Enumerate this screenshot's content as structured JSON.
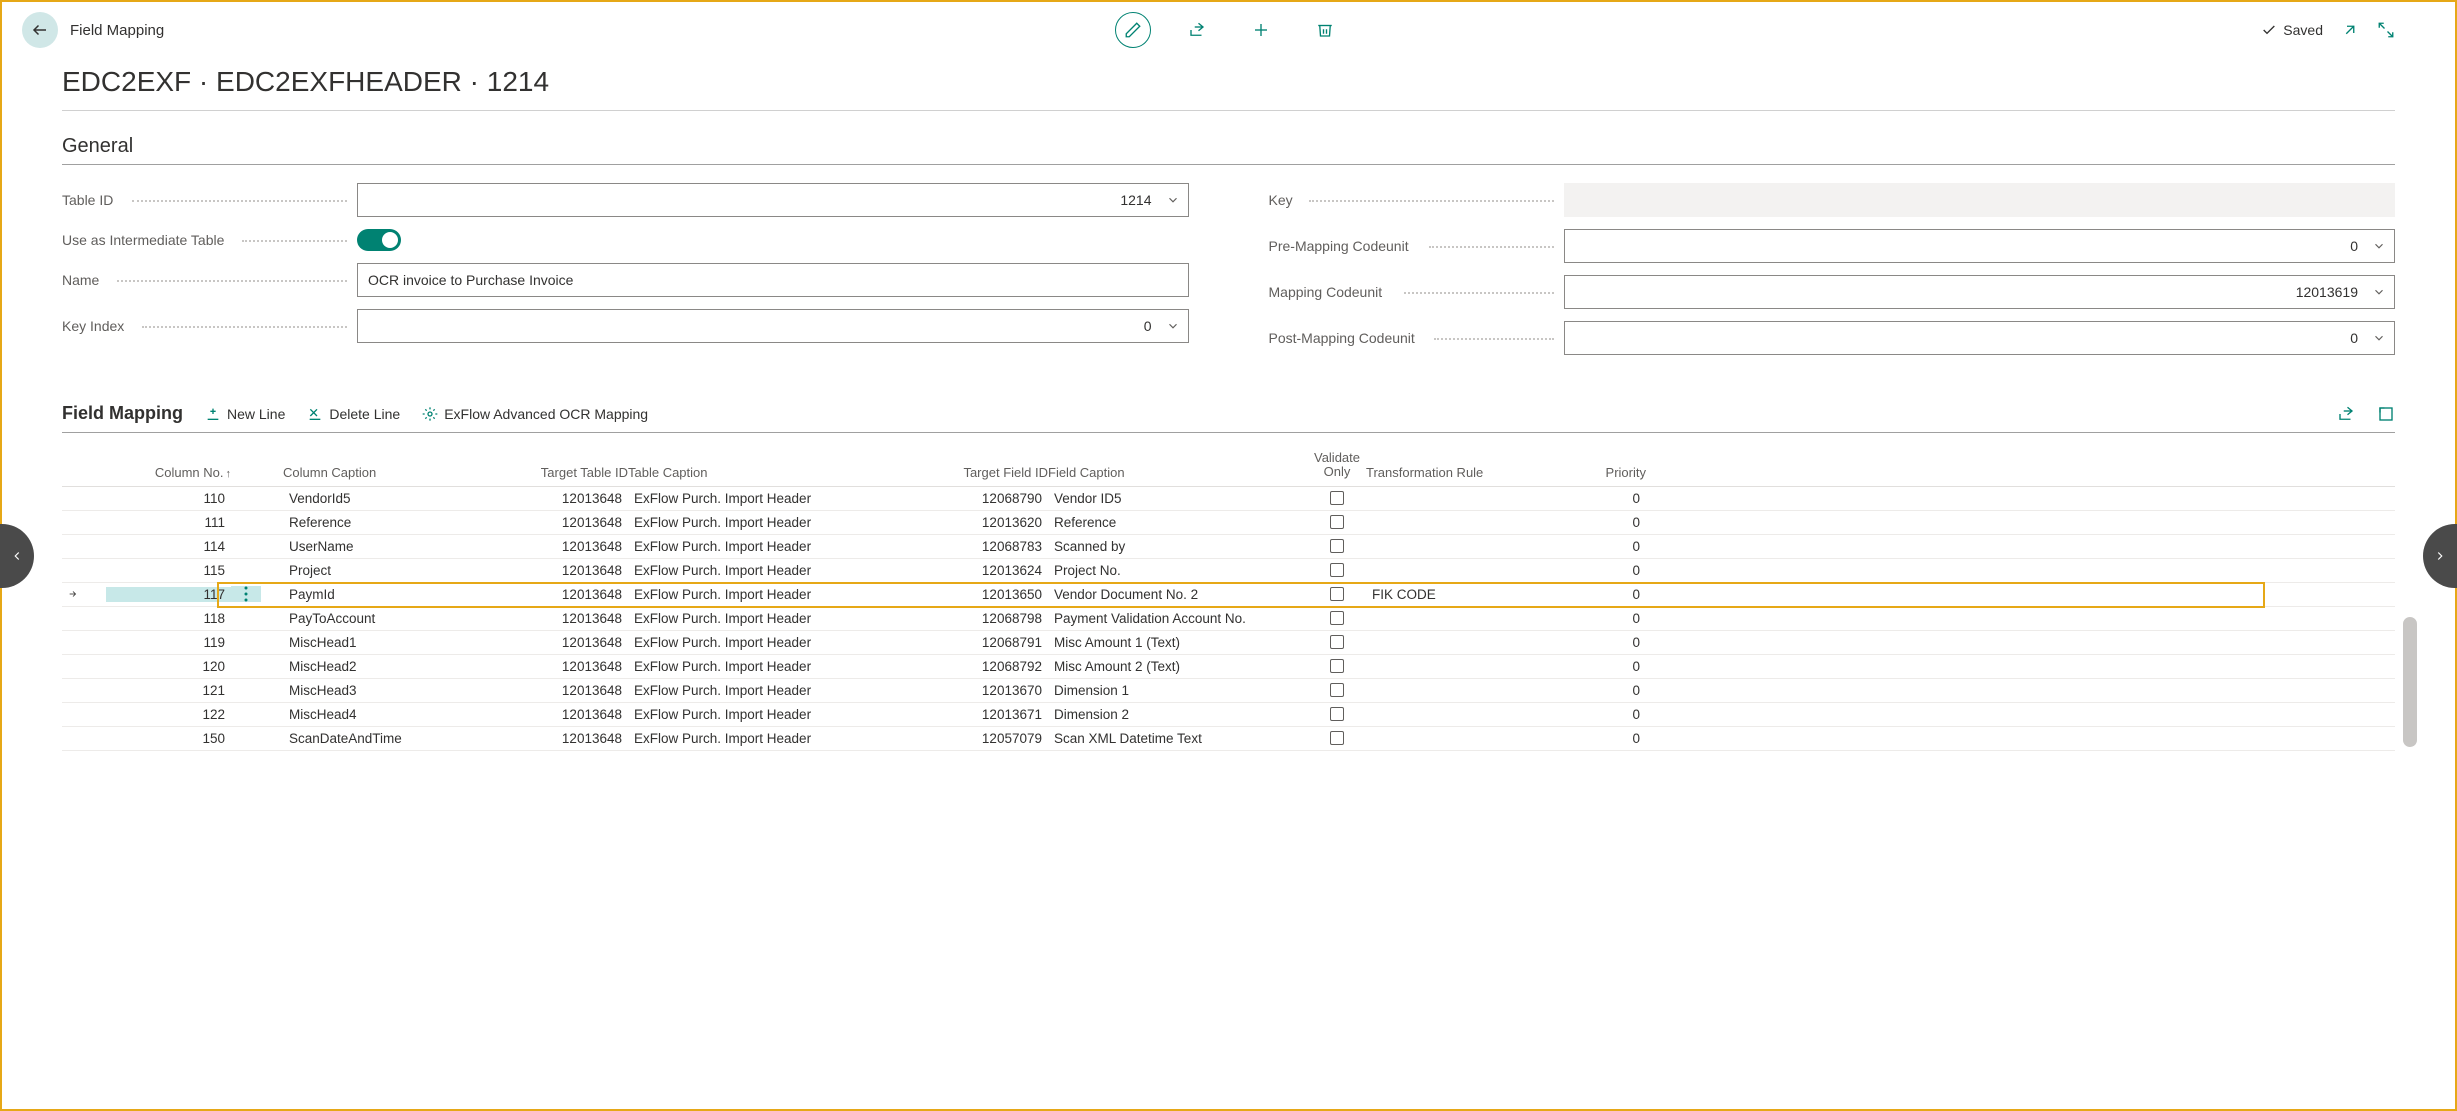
{
  "header": {
    "page_type": "Field Mapping",
    "title": "EDC2EXF · EDC2EXFHEADER · 1214",
    "saved_label": "Saved"
  },
  "general": {
    "section_title": "General",
    "labels": {
      "table_id": "Table ID",
      "use_intermediate": "Use as Intermediate Table",
      "name": "Name",
      "key_index": "Key Index",
      "key": "Key",
      "pre_mapping": "Pre-Mapping Codeunit",
      "mapping": "Mapping Codeunit",
      "post_mapping": "Post-Mapping Codeunit"
    },
    "values": {
      "table_id": "1214",
      "use_intermediate": true,
      "name": "OCR invoice to Purchase Invoice",
      "key_index": "0",
      "key": "",
      "pre_mapping": "0",
      "mapping": "12013619",
      "post_mapping": "0"
    }
  },
  "subpage": {
    "title": "Field Mapping",
    "actions": {
      "new_line": "New Line",
      "delete_line": "Delete Line",
      "advanced": "ExFlow Advanced OCR Mapping"
    },
    "columns": {
      "column_no": "Column No.",
      "column_caption": "Column Caption",
      "target_table_id": "Target Table ID",
      "table_caption": "Table Caption",
      "target_field_id": "Target Field ID",
      "field_caption": "Field Caption",
      "validate_only_l1": "Validate",
      "validate_only_l2": "Only",
      "transformation_rule": "Transformation Rule",
      "priority": "Priority"
    },
    "rows": [
      {
        "col_no": "110",
        "col_caption": "VendorId5",
        "tgt_table": "12013648",
        "tbl_caption": "ExFlow Purch. Import Header",
        "tgt_field": "12068790",
        "fld_caption": "Vendor ID5",
        "validate": false,
        "rule": "",
        "priority": "0",
        "selected": false
      },
      {
        "col_no": "111",
        "col_caption": "Reference",
        "tgt_table": "12013648",
        "tbl_caption": "ExFlow Purch. Import Header",
        "tgt_field": "12013620",
        "fld_caption": "Reference",
        "validate": false,
        "rule": "",
        "priority": "0",
        "selected": false
      },
      {
        "col_no": "114",
        "col_caption": "UserName",
        "tgt_table": "12013648",
        "tbl_caption": "ExFlow Purch. Import Header",
        "tgt_field": "12068783",
        "fld_caption": "Scanned by",
        "validate": false,
        "rule": "",
        "priority": "0",
        "selected": false
      },
      {
        "col_no": "115",
        "col_caption": "Project",
        "tgt_table": "12013648",
        "tbl_caption": "ExFlow Purch. Import Header",
        "tgt_field": "12013624",
        "fld_caption": "Project No.",
        "validate": false,
        "rule": "",
        "priority": "0",
        "selected": false
      },
      {
        "col_no": "117",
        "col_caption": "PaymId",
        "tgt_table": "12013648",
        "tbl_caption": "ExFlow Purch. Import Header",
        "tgt_field": "12013650",
        "fld_caption": "Vendor Document No. 2",
        "validate": false,
        "rule": "FIK CODE",
        "priority": "0",
        "selected": true
      },
      {
        "col_no": "118",
        "col_caption": "PayToAccount",
        "tgt_table": "12013648",
        "tbl_caption": "ExFlow Purch. Import Header",
        "tgt_field": "12068798",
        "fld_caption": "Payment Validation Account No.",
        "validate": false,
        "rule": "",
        "priority": "0",
        "selected": false
      },
      {
        "col_no": "119",
        "col_caption": "MiscHead1",
        "tgt_table": "12013648",
        "tbl_caption": "ExFlow Purch. Import Header",
        "tgt_field": "12068791",
        "fld_caption": "Misc Amount 1 (Text)",
        "validate": false,
        "rule": "",
        "priority": "0",
        "selected": false
      },
      {
        "col_no": "120",
        "col_caption": "MiscHead2",
        "tgt_table": "12013648",
        "tbl_caption": "ExFlow Purch. Import Header",
        "tgt_field": "12068792",
        "fld_caption": "Misc Amount 2 (Text)",
        "validate": false,
        "rule": "",
        "priority": "0",
        "selected": false
      },
      {
        "col_no": "121",
        "col_caption": "MiscHead3",
        "tgt_table": "12013648",
        "tbl_caption": "ExFlow Purch. Import Header",
        "tgt_field": "12013670",
        "fld_caption": "Dimension 1",
        "validate": false,
        "rule": "",
        "priority": "0",
        "selected": false
      },
      {
        "col_no": "122",
        "col_caption": "MiscHead4",
        "tgt_table": "12013648",
        "tbl_caption": "ExFlow Purch. Import Header",
        "tgt_field": "12013671",
        "fld_caption": "Dimension 2",
        "validate": false,
        "rule": "",
        "priority": "0",
        "selected": false
      },
      {
        "col_no": "150",
        "col_caption": "ScanDateAndTime",
        "tgt_table": "12013648",
        "tbl_caption": "ExFlow Purch. Import Header",
        "tgt_field": "12057079",
        "fld_caption": "Scan XML Datetime Text",
        "validate": false,
        "rule": "",
        "priority": "0",
        "selected": false
      }
    ]
  },
  "colors": {
    "accent": "#008272",
    "highlight": "#e6a817"
  }
}
